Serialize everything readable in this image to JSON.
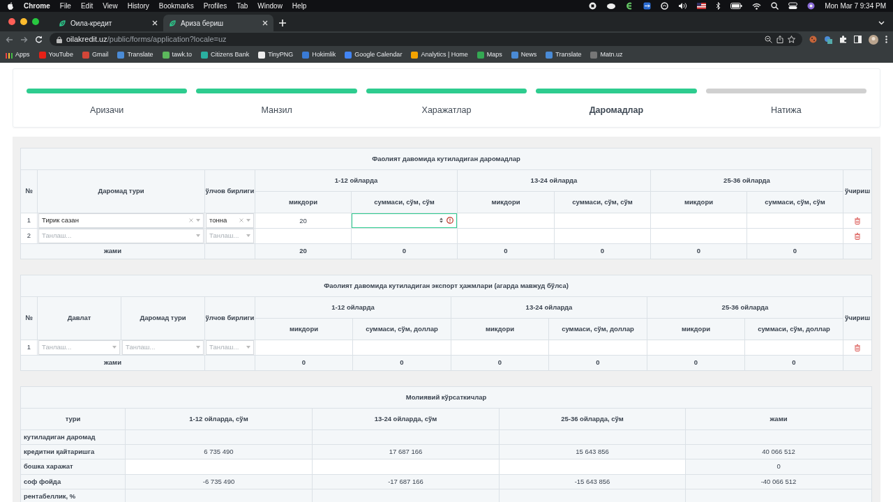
{
  "menubar": {
    "app": "Chrome",
    "menus": [
      "File",
      "Edit",
      "View",
      "History",
      "Bookmarks",
      "Profiles",
      "Tab",
      "Window",
      "Help"
    ],
    "clock": "Mon Mar 7  9:34 PM"
  },
  "browser": {
    "tabs": [
      {
        "title": "Оила-кредит",
        "selected": false
      },
      {
        "title": "Ариза бериш",
        "selected": true
      }
    ],
    "address": {
      "host": "oilakredit.uz",
      "path": "/public/forms/application?locale=uz"
    },
    "bookmarks": [
      "Apps",
      "YouTube",
      "Gmail",
      "Translate",
      "tawk.to",
      "Citizens Bank",
      "TinyPNG",
      "Hokimlik",
      "Google Calendar",
      "Analytics | Home",
      "Maps",
      "News",
      "Translate",
      "Matn.uz"
    ]
  },
  "steps": [
    {
      "label": "Аризачи",
      "done": true,
      "selected": false
    },
    {
      "label": "Манзил",
      "done": true,
      "selected": false
    },
    {
      "label": "Харажатлар",
      "done": true,
      "selected": false
    },
    {
      "label": "Даромадлар",
      "done": true,
      "selected": true
    },
    {
      "label": "Натижа",
      "done": false,
      "selected": false
    }
  ],
  "income_table": {
    "title": "Фаолият давомида кутиладиган даромадлар",
    "headers": {
      "number": "№",
      "fields": [
        "Даромад тури",
        "ўлчов бирлиги"
      ],
      "delete": "ўчириш"
    },
    "periods": [
      {
        "label": "1-12 ойларда",
        "columns": [
          "микдори",
          "суммаси, сўм, сўм"
        ]
      },
      {
        "label": "13-24 ойларда",
        "columns": [
          "микдори",
          "суммаси, сўм, сўм"
        ]
      },
      {
        "label": "25-36 ойларда",
        "columns": [
          "микдори",
          "суммаси, сўм, сўм"
        ]
      }
    ],
    "rows": [
      {
        "number": "1",
        "selects": [
          {
            "value": "Тирик сазан"
          },
          {
            "value": "тонна"
          }
        ],
        "cells": [
          {
            "value": "20",
            "focused": false,
            "error": false
          },
          {
            "focused": true,
            "error": true
          },
          {
            "focused": false,
            "error": false
          },
          {
            "focused": false,
            "error": false
          },
          {
            "focused": false,
            "error": false
          },
          {
            "focused": false,
            "error": false
          }
        ]
      },
      {
        "number": "2",
        "selects": [
          {
            "placeholder": "Танлаш..."
          },
          {
            "placeholder": "Танлаш..."
          }
        ],
        "cells": [
          {
            "focused": false,
            "error": false
          },
          {
            "focused": false,
            "error": false
          },
          {
            "focused": false,
            "error": false
          },
          {
            "focused": false,
            "error": false
          },
          {
            "focused": false,
            "error": false
          },
          {
            "focused": false,
            "error": false
          }
        ]
      }
    ],
    "totals": {
      "label": "жами",
      "values": [
        "20",
        "0",
        "0",
        "0",
        "0",
        "0"
      ]
    }
  },
  "export_table": {
    "title": "Фаолият давомида кутиладиган экспорт ҳажмлари (агарда мавжуд бўлса)",
    "headers": {
      "number": "№",
      "fields": [
        "Давлат",
        "Даромад тури",
        "ўлчов бирлиги"
      ],
      "delete": "ўчириш"
    },
    "periods": [
      {
        "label": "1-12 ойларда",
        "columns": [
          "микдори",
          "суммаси, сўм, доллар"
        ]
      },
      {
        "label": "13-24 ойларда",
        "columns": [
          "микдори",
          "суммаси, сўм, доллар"
        ]
      },
      {
        "label": "25-36 ойларда",
        "columns": [
          "микдори",
          "суммаси, сўм, доллар"
        ]
      }
    ],
    "rows": [
      {
        "number": "1",
        "selects": [
          {
            "placeholder": "Танлаш..."
          },
          {
            "placeholder": "Танлаш..."
          },
          {
            "placeholder": "Танлаш..."
          }
        ],
        "cells": [
          {
            "focused": false,
            "error": false
          },
          {
            "focused": false,
            "error": false
          },
          {
            "focused": false,
            "error": false
          },
          {
            "focused": false,
            "error": false
          },
          {
            "focused": false,
            "error": false
          },
          {
            "focused": false,
            "error": false
          }
        ]
      }
    ],
    "totals": {
      "label": "жами",
      "values": [
        "0",
        "0",
        "0",
        "0",
        "0",
        "0"
      ]
    }
  },
  "financial_table": {
    "title": "Молиявий кўрсаткичлар",
    "columns": [
      "тури",
      "1-12 ойларда, сўм",
      "13-24 ойларда, сўм",
      "25-36 ойларда, сўм",
      "жами"
    ],
    "rows": [
      {
        "label": "кутиладиган даромад",
        "kind": "computed"
      },
      {
        "label": "кредитни қайтаришга",
        "kind": "computed",
        "values": [
          "6 735 490",
          "17 687 166",
          "15 643 856",
          "40 066 512"
        ]
      },
      {
        "label": "бошка харажат",
        "kind": "input",
        "total": "0"
      },
      {
        "label": "соф фойда",
        "kind": "computed",
        "values": [
          "-6 735 490",
          "-17 687 166",
          "-15 643 856",
          "-40 066 512"
        ]
      },
      {
        "label": "рентабеллик, %",
        "kind": "computed"
      }
    ]
  }
}
